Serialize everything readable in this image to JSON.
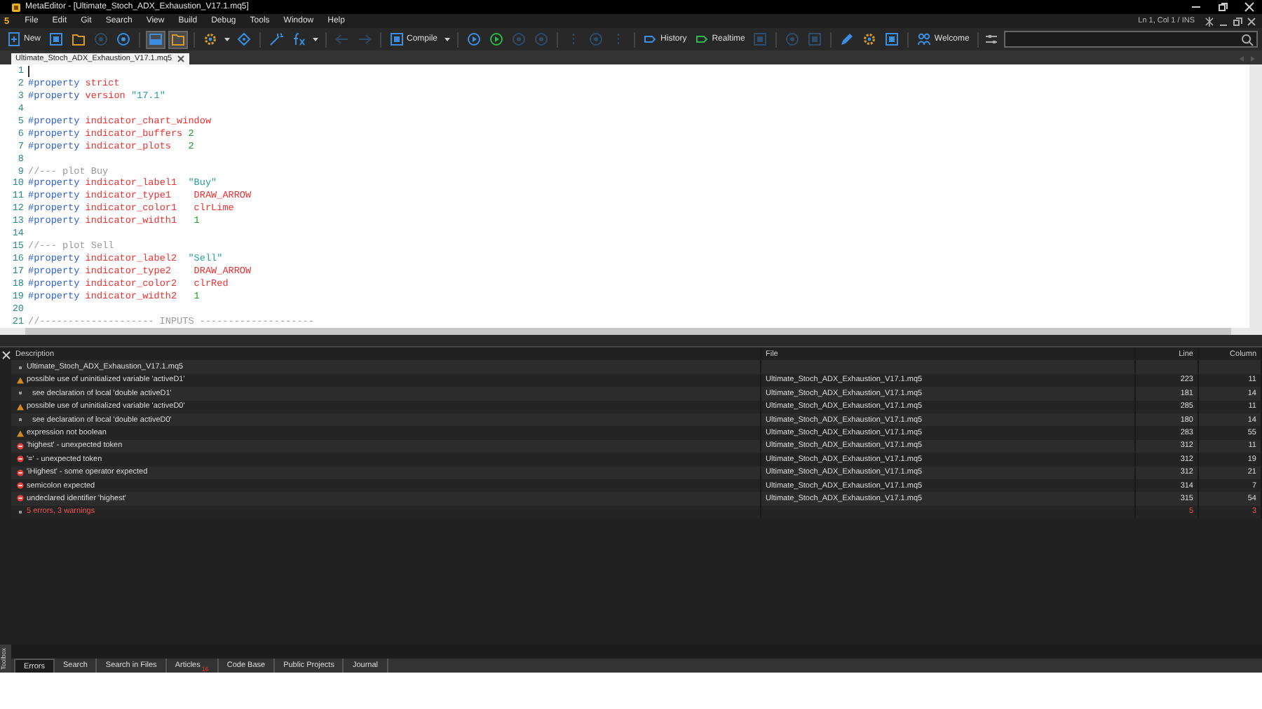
{
  "window": {
    "title": "MetaEditor - [Ultimate_Stoch_ADX_Exhaustion_V17.1.mq5]"
  },
  "menu": {
    "logo": "5",
    "items": [
      "File",
      "Edit",
      "Git",
      "Search",
      "View",
      "Build",
      "Debug",
      "Tools",
      "Window",
      "Help"
    ],
    "status": "Ln 1, Col 1 / INS"
  },
  "toolbar": [
    {
      "kind": "labeled",
      "label": "New",
      "disabled": false,
      "pressed": false
    },
    {
      "kind": "icon",
      "disabled": false,
      "pressed": false
    },
    {
      "kind": "icon",
      "disabled": false,
      "pressed": false
    },
    {
      "kind": "icon",
      "disabled": true,
      "pressed": false
    },
    {
      "kind": "icon",
      "disabled": false,
      "pressed": false
    },
    {
      "kind": "separator"
    },
    {
      "kind": "icon",
      "disabled": false,
      "pressed": true
    },
    {
      "kind": "icon",
      "disabled": false,
      "pressed": true
    },
    {
      "kind": "separator"
    },
    {
      "kind": "dropdown",
      "disabled": false,
      "pressed": false
    },
    {
      "kind": "icon",
      "disabled": false,
      "pressed": false
    },
    {
      "kind": "separator"
    },
    {
      "kind": "icon",
      "disabled": false,
      "pressed": false
    },
    {
      "kind": "dropdown",
      "disabled": false,
      "pressed": false
    },
    {
      "kind": "separator"
    },
    {
      "kind": "icon",
      "disabled": true,
      "pressed": false
    },
    {
      "kind": "icon",
      "disabled": true,
      "pressed": false
    },
    {
      "kind": "separator"
    },
    {
      "kind": "labeled_dropdown",
      "label": "Compile",
      "disabled": false,
      "pressed": false
    },
    {
      "kind": "separator"
    },
    {
      "kind": "icon",
      "disabled": false,
      "pressed": false
    },
    {
      "kind": "icon",
      "disabled": false,
      "pressed": false
    },
    {
      "kind": "icon",
      "disabled": true,
      "pressed": false
    },
    {
      "kind": "icon",
      "disabled": true,
      "pressed": false
    },
    {
      "kind": "separator"
    },
    {
      "kind": "icon",
      "disabled": true,
      "pressed": false
    },
    {
      "kind": "icon",
      "disabled": true,
      "pressed": false
    },
    {
      "kind": "icon",
      "disabled": true,
      "pressed": false
    },
    {
      "kind": "separator"
    },
    {
      "kind": "labeled",
      "label": "History",
      "disabled": false,
      "pressed": false
    },
    {
      "kind": "labeled",
      "label": "Realtime",
      "disabled": false,
      "pressed": false
    },
    {
      "kind": "icon",
      "disabled": true,
      "pressed": false
    },
    {
      "kind": "separator"
    },
    {
      "kind": "icon",
      "disabled": true,
      "pressed": false
    },
    {
      "kind": "icon",
      "disabled": true,
      "pressed": false
    },
    {
      "kind": "separator"
    },
    {
      "kind": "icon",
      "disabled": false,
      "pressed": false
    },
    {
      "kind": "icon",
      "disabled": false,
      "pressed": false
    },
    {
      "kind": "icon",
      "disabled": false,
      "pressed": false
    },
    {
      "kind": "separator"
    },
    {
      "kind": "labeled",
      "label": "Welcome",
      "disabled": false,
      "pressed": false
    }
  ],
  "document_tab": {
    "label": "Ultimate_Stoch_ADX_Exhaustion_V17.1.mq5",
    "selected": true
  },
  "code": [
    {
      "number": "1"
    },
    {
      "number": "2",
      "tokens": [
        {
          "kind": "directive",
          "text": "#property"
        },
        {
          "kind": "keyword",
          "text": " strict"
        }
      ]
    },
    {
      "number": "3",
      "tokens": [
        {
          "kind": "directive",
          "text": "#property"
        },
        {
          "kind": "keyword",
          "text": " version"
        },
        {
          "kind": "string",
          "text": " \"17.1\""
        }
      ]
    },
    {
      "number": "4"
    },
    {
      "number": "5",
      "tokens": [
        {
          "kind": "directive",
          "text": "#property"
        },
        {
          "kind": "keyword",
          "text": " indicator_chart_window"
        }
      ]
    },
    {
      "number": "6",
      "tokens": [
        {
          "kind": "directive",
          "text": "#property"
        },
        {
          "kind": "keyword",
          "text": " indicator_buffers"
        },
        {
          "kind": "number",
          "text": " 2"
        }
      ]
    },
    {
      "number": "7",
      "tokens": [
        {
          "kind": "directive",
          "text": "#property"
        },
        {
          "kind": "keyword",
          "text": " indicator_plots"
        },
        {
          "kind": "number",
          "text": "   2"
        }
      ]
    },
    {
      "number": "8"
    },
    {
      "number": "9",
      "tokens": [
        {
          "kind": "comment",
          "text": "//--- plot Buy"
        }
      ]
    },
    {
      "number": "10",
      "tokens": [
        {
          "kind": "directive",
          "text": "#property"
        },
        {
          "kind": "keyword",
          "text": " indicator_label1"
        },
        {
          "kind": "string",
          "text": "  \"Buy\""
        }
      ]
    },
    {
      "number": "11",
      "tokens": [
        {
          "kind": "directive",
          "text": "#property"
        },
        {
          "kind": "keyword",
          "text": " indicator_type1    DRAW_ARROW"
        }
      ]
    },
    {
      "number": "12",
      "tokens": [
        {
          "kind": "directive",
          "text": "#property"
        },
        {
          "kind": "keyword",
          "text": " indicator_color1   clrLime"
        }
      ]
    },
    {
      "number": "13",
      "tokens": [
        {
          "kind": "directive",
          "text": "#property"
        },
        {
          "kind": "keyword",
          "text": " indicator_width1"
        },
        {
          "kind": "number",
          "text": "   1"
        }
      ]
    },
    {
      "number": "14"
    },
    {
      "number": "15",
      "tokens": [
        {
          "kind": "comment",
          "text": "//--- plot Sell"
        }
      ]
    },
    {
      "number": "16",
      "tokens": [
        {
          "kind": "directive",
          "text": "#property"
        },
        {
          "kind": "keyword",
          "text": " indicator_label2"
        },
        {
          "kind": "string",
          "text": "  \"Sell\""
        }
      ]
    },
    {
      "number": "17",
      "tokens": [
        {
          "kind": "directive",
          "text": "#property"
        },
        {
          "kind": "keyword",
          "text": " indicator_type2    DRAW_ARROW"
        }
      ]
    },
    {
      "number": "18",
      "tokens": [
        {
          "kind": "directive",
          "text": "#property"
        },
        {
          "kind": "keyword",
          "text": " indicator_color2   clrRed"
        }
      ]
    },
    {
      "number": "19",
      "tokens": [
        {
          "kind": "directive",
          "text": "#property"
        },
        {
          "kind": "keyword",
          "text": " indicator_width2"
        },
        {
          "kind": "number",
          "text": "   1"
        }
      ]
    },
    {
      "number": "20"
    },
    {
      "number": "21",
      "tokens": [
        {
          "kind": "comment",
          "text": "//-------------------- INPUTS --------------------"
        }
      ]
    }
  ],
  "errors": {
    "columns": [
      "Description",
      "File",
      "Line",
      "Column"
    ],
    "rows": [
      {
        "kind": "file",
        "description": "Ultimate_Stoch_ADX_Exhaustion_V17.1.mq5"
      },
      {
        "kind": "warning",
        "description": "possible use of uninitialized variable 'activeD1'",
        "file": "Ultimate_Stoch_ADX_Exhaustion_V17.1.mq5",
        "line": "223",
        "column": "11"
      },
      {
        "kind": "info",
        "description": "see declaration of local 'double activeD1'",
        "file": "Ultimate_Stoch_ADX_Exhaustion_V17.1.mq5",
        "line": "181",
        "column": "14"
      },
      {
        "kind": "warning",
        "description": "possible use of uninitialized variable 'activeD0'",
        "file": "Ultimate_Stoch_ADX_Exhaustion_V17.1.mq5",
        "line": "285",
        "column": "11"
      },
      {
        "kind": "info",
        "description": "see declaration of local 'double activeD0'",
        "file": "Ultimate_Stoch_ADX_Exhaustion_V17.1.mq5",
        "line": "180",
        "column": "14"
      },
      {
        "kind": "warning",
        "description": "expression not boolean",
        "file": "Ultimate_Stoch_ADX_Exhaustion_V17.1.mq5",
        "line": "283",
        "column": "55"
      },
      {
        "kind": "error",
        "description": "'highest' - unexpected token",
        "file": "Ultimate_Stoch_ADX_Exhaustion_V17.1.mq5",
        "line": "312",
        "column": "11"
      },
      {
        "kind": "error",
        "description": "'=' - unexpected token",
        "file": "Ultimate_Stoch_ADX_Exhaustion_V17.1.mq5",
        "line": "312",
        "column": "19"
      },
      {
        "kind": "error",
        "description": "'iHighest' - some operator expected",
        "file": "Ultimate_Stoch_ADX_Exhaustion_V17.1.mq5",
        "line": "312",
        "column": "21"
      },
      {
        "kind": "error",
        "description": "semicolon expected",
        "file": "Ultimate_Stoch_ADX_Exhaustion_V17.1.mq5",
        "line": "314",
        "column": "7"
      },
      {
        "kind": "error",
        "description": "undeclared identifier 'highest'",
        "file": "Ultimate_Stoch_ADX_Exhaustion_V17.1.mq5",
        "line": "315",
        "column": "54"
      },
      {
        "kind": "summary",
        "description": "5 errors, 3 warnings",
        "line": "5",
        "column": "3"
      }
    ]
  },
  "toolbox": {
    "title": "Toolbox",
    "tabs": [
      {
        "label": "Errors",
        "selected": true
      },
      {
        "label": "Search",
        "selected": false
      },
      {
        "label": "Search in Files",
        "selected": false
      },
      {
        "label": "Articles",
        "badge": "16",
        "selected": false
      },
      {
        "label": "Code Base",
        "selected": false
      },
      {
        "label": "Public Projects",
        "selected": false
      },
      {
        "label": "Journal",
        "selected": false
      }
    ]
  }
}
